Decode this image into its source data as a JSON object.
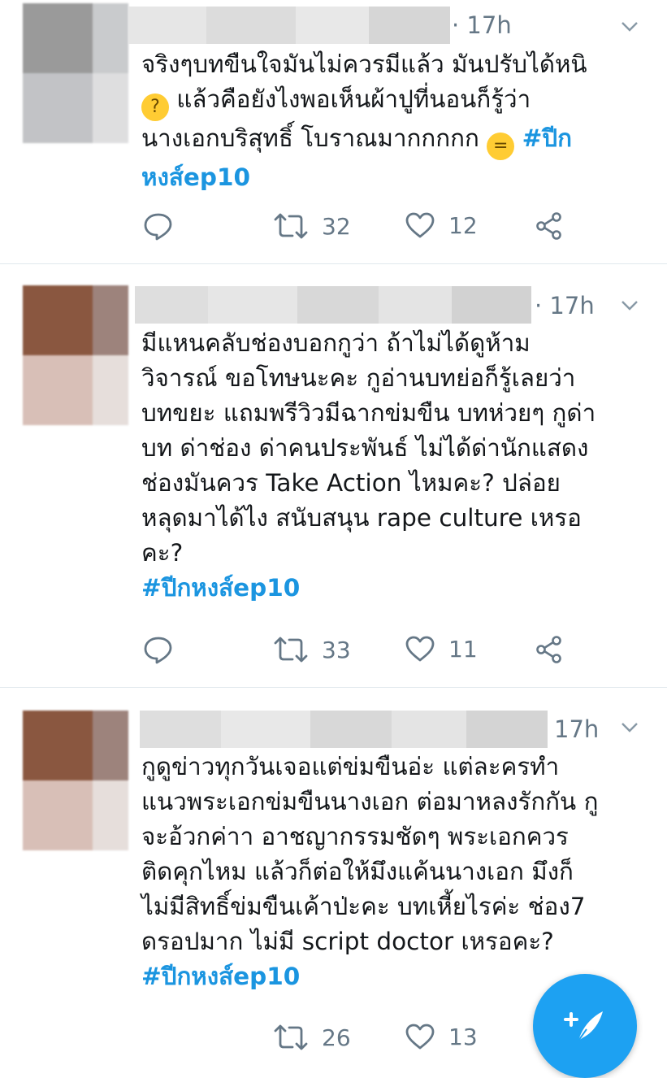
{
  "colors": {
    "accent": "#1b95e0",
    "meta": "#657786",
    "divider": "#e1e8ed",
    "fab": "#1da1f2"
  },
  "tweets": [
    {
      "time": "· 17h",
      "lines": [
        [
          {
            "t": "จริงๆบทขืนใจมันไม่ควรมีแล้ว มันปรับได้หนิ"
          }
        ],
        [
          {
            "emoji": "thinking-face"
          },
          {
            "t": " แล้วคือยังไงพอเห็นผ้าปูที่นอนก็รู้ว่า"
          }
        ],
        [
          {
            "t": "นางเอกบริสุทธิ์ โบราณมากกกกก "
          },
          {
            "emoji": "expressionless-face"
          },
          {
            "t": " "
          },
          {
            "tag": "#ปีก"
          }
        ],
        [
          {
            "tag": "หงส์ep10"
          }
        ]
      ],
      "retweets": "32",
      "likes": "12"
    },
    {
      "time": "· 17h",
      "lines": [
        [
          {
            "t": "มีแหนคลับช่องบอกกูว่า ถ้าไม่ได้ดูห้าม"
          }
        ],
        [
          {
            "t": "วิจารณ์ ขอโทษนะคะ กูอ่านบทย่อก็รู้เลยว่า"
          }
        ],
        [
          {
            "t": "บทขยะ แถมพรีวิวมีฉากข่มขืน บทห่วยๆ กูด่า"
          }
        ],
        [
          {
            "t": "บท ด่าช่อง ด่าคนประพันธ์ ไม่ได้ด่านักแสดง"
          }
        ],
        [
          {
            "t": "ช่องมันควร Take Action ไหมคะ? ปล่อย"
          }
        ],
        [
          {
            "t": "หลุดมาได้ไง สนับสนุน rape culture เหรอ"
          }
        ],
        [
          {
            "t": "คะ?"
          }
        ],
        [
          {
            "tag": "#ปีกหงส์ep10"
          }
        ]
      ],
      "retweets": "33",
      "likes": "11"
    },
    {
      "time": "17h",
      "lines": [
        [
          {
            "t": "กูดูข่าวทุกวันเจอแต่ข่มขืนอ่ะ แต่ละครทำ"
          }
        ],
        [
          {
            "t": "แนวพระเอกข่มขืนนางเอก ต่อมาหลงรักกัน กู"
          }
        ],
        [
          {
            "t": "จะอ้วกค่าา  อาชญากรรมชัดๆ พระเอกควร"
          }
        ],
        [
          {
            "t": "ติดคุกไหม แล้วก็ต่อให้มึงแค้นนางเอก มึงก็"
          }
        ],
        [
          {
            "t": "ไม่มีสิทธิ์ข่มขืนเค้าป่ะคะ บทเหี้ยไรค่ะ ช่อง7"
          }
        ],
        [
          {
            "t": "ดรอปมาก ไม่มี  script doctor เหรอคะ?"
          }
        ],
        [
          {
            "tag": "#ปีกหงส์ep10"
          }
        ]
      ],
      "retweets": "26",
      "likes": "13"
    }
  ]
}
